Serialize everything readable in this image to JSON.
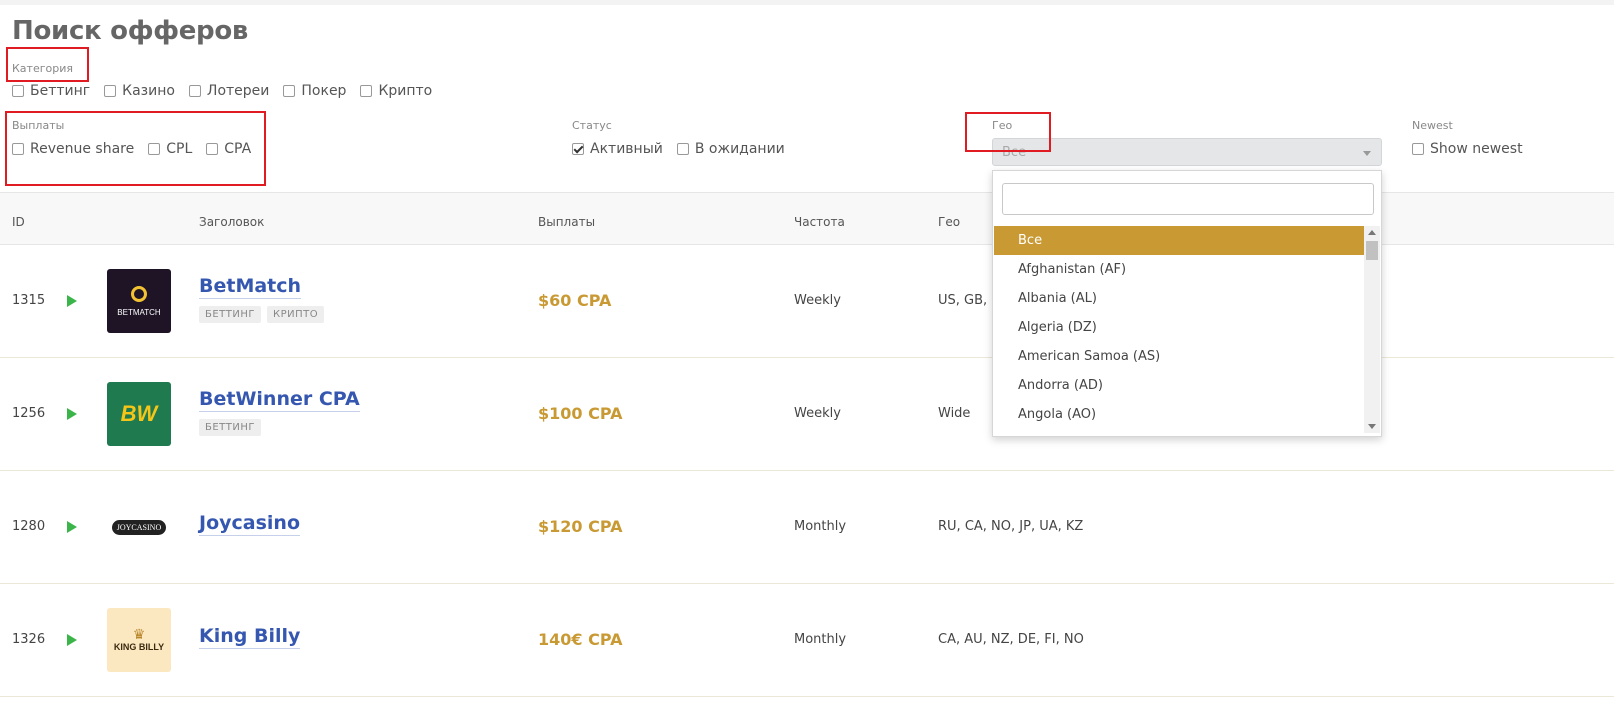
{
  "page": {
    "title": "Поиск офферов"
  },
  "filters": {
    "category": {
      "label": "Категория",
      "options": [
        {
          "label": "Беттинг",
          "checked": false
        },
        {
          "label": "Казино",
          "checked": false
        },
        {
          "label": "Лотереи",
          "checked": false
        },
        {
          "label": "Покер",
          "checked": false
        },
        {
          "label": "Крипто",
          "checked": false
        }
      ]
    },
    "payouts": {
      "label": "Выплаты",
      "options": [
        {
          "label": "Revenue share",
          "checked": false
        },
        {
          "label": "CPL",
          "checked": false
        },
        {
          "label": "CPA",
          "checked": false
        }
      ]
    },
    "status": {
      "label": "Статус",
      "options": [
        {
          "label": "Активный",
          "checked": true
        },
        {
          "label": "В ожидании",
          "checked": false
        }
      ]
    },
    "geo": {
      "label": "Гео",
      "selected": "Все"
    },
    "newest": {
      "label": "Newest",
      "option": "Show newest",
      "checked": false
    }
  },
  "table": {
    "headers": {
      "id": "ID",
      "title": "Заголовок",
      "payouts": "Выплаты",
      "frequency": "Частота",
      "geo": "Гео"
    },
    "rows": [
      {
        "id": "1315",
        "title": "BetMatch",
        "tags": [
          "БЕТТИНГ",
          "КРИПТО"
        ],
        "payout": "$60 CPA",
        "frequency": "Weekly",
        "geo": "US, GB, C",
        "logo_text": "BETMATCH"
      },
      {
        "id": "1256",
        "title": "BetWinner CPA",
        "tags": [
          "БЕТТИНГ"
        ],
        "payout": "$100 CPA",
        "frequency": "Weekly",
        "geo": "Wide",
        "logo_text": "BW"
      },
      {
        "id": "1280",
        "title": "Joycasino",
        "tags": [],
        "payout": "$120 CPA",
        "frequency": "Monthly",
        "geo": "RU, CA, NO, JP, UA, KZ",
        "logo_text": "JOYCASINO"
      },
      {
        "id": "1326",
        "title": "King Billy",
        "tags": [],
        "payout": "140€ CPA",
        "frequency": "Monthly",
        "geo": "CA, AU, NZ, DE, FI, NO",
        "logo_text": "KING BILLY"
      }
    ]
  },
  "geo_dropdown": {
    "search_value": "",
    "items": [
      "Все",
      "Afghanistan (AF)",
      "Albania (AL)",
      "Algeria (DZ)",
      "American Samoa (AS)",
      "Andorra (AD)",
      "Angola (AO)"
    ],
    "selected_index": 0
  },
  "colors": {
    "accent": "#c99a34",
    "link": "#3557b0",
    "play": "#3bb54a",
    "highlight": "#e01b22"
  }
}
